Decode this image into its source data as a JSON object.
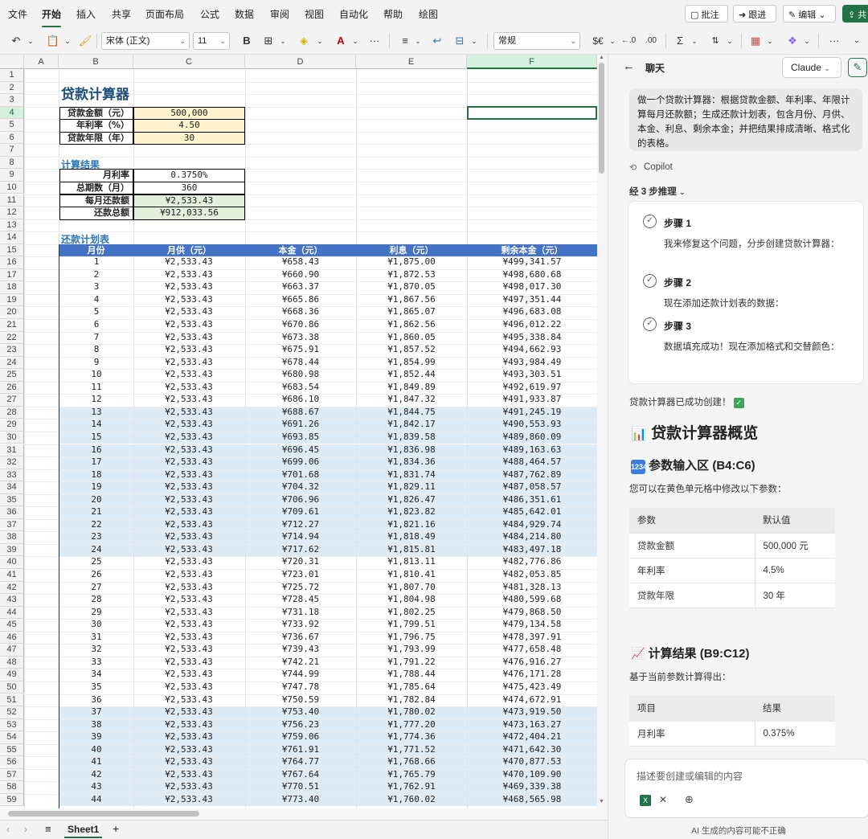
{
  "menu": {
    "items": [
      "文件",
      "开始",
      "插入",
      "共享",
      "页面布局",
      "公式",
      "数据",
      "审阅",
      "视图",
      "自动化",
      "帮助",
      "绘图"
    ],
    "active": "开始",
    "comment_label": "批注",
    "track_label": "跟进",
    "edit_label": "编辑",
    "share_label": "共"
  },
  "toolbar": {
    "font_name": "宋体 (正文)",
    "font_size": "11",
    "number_format": "常规",
    "bold": "B",
    "currency": "$€",
    "sigma": "Σ"
  },
  "columns": [
    "A",
    "B",
    "C",
    "D",
    "E",
    "F"
  ],
  "selected_column": "F",
  "selected_row": 4,
  "sheet": {
    "title": "贷款计算器",
    "inputs": [
      {
        "label": "贷款金额（元）",
        "value": "500,000"
      },
      {
        "label": "年利率（%）",
        "value": "4.50"
      },
      {
        "label": "贷款年限（年）",
        "value": "30"
      }
    ],
    "results_title": "计算结果",
    "results": [
      {
        "label": "月利率",
        "value": "0.3750%"
      },
      {
        "label": "总期数（月）",
        "value": "360"
      },
      {
        "label": "每月还款额",
        "value": "¥2,533.43"
      },
      {
        "label": "还款总额",
        "value": "¥912,033.56"
      }
    ],
    "schedule_title": "还款计划表",
    "headers": [
      "月份",
      "月供（元）",
      "本金（元）",
      "利息（元）",
      "剩余本金（元）"
    ],
    "rows": [
      [
        "1",
        "¥2,533.43",
        "¥658.43",
        "¥1,875.00",
        "¥499,341.57"
      ],
      [
        "2",
        "¥2,533.43",
        "¥660.90",
        "¥1,872.53",
        "¥498,680.68"
      ],
      [
        "3",
        "¥2,533.43",
        "¥663.37",
        "¥1,870.05",
        "¥498,017.30"
      ],
      [
        "4",
        "¥2,533.43",
        "¥665.86",
        "¥1,867.56",
        "¥497,351.44"
      ],
      [
        "5",
        "¥2,533.43",
        "¥668.36",
        "¥1,865.07",
        "¥496,683.08"
      ],
      [
        "6",
        "¥2,533.43",
        "¥670.86",
        "¥1,862.56",
        "¥496,012.22"
      ],
      [
        "7",
        "¥2,533.43",
        "¥673.38",
        "¥1,860.05",
        "¥495,338.84"
      ],
      [
        "8",
        "¥2,533.43",
        "¥675.91",
        "¥1,857.52",
        "¥494,662.93"
      ],
      [
        "9",
        "¥2,533.43",
        "¥678.44",
        "¥1,854.99",
        "¥493,984.49"
      ],
      [
        "10",
        "¥2,533.43",
        "¥680.98",
        "¥1,852.44",
        "¥493,303.51"
      ],
      [
        "11",
        "¥2,533.43",
        "¥683.54",
        "¥1,849.89",
        "¥492,619.97"
      ],
      [
        "12",
        "¥2,533.43",
        "¥686.10",
        "¥1,847.32",
        "¥491,933.87"
      ],
      [
        "13",
        "¥2,533.43",
        "¥688.67",
        "¥1,844.75",
        "¥491,245.19"
      ],
      [
        "14",
        "¥2,533.43",
        "¥691.26",
        "¥1,842.17",
        "¥490,553.93"
      ],
      [
        "15",
        "¥2,533.43",
        "¥693.85",
        "¥1,839.58",
        "¥489,860.09"
      ],
      [
        "16",
        "¥2,533.43",
        "¥696.45",
        "¥1,836.98",
        "¥489,163.63"
      ],
      [
        "17",
        "¥2,533.43",
        "¥699.06",
        "¥1,834.36",
        "¥488,464.57"
      ],
      [
        "18",
        "¥2,533.43",
        "¥701.68",
        "¥1,831.74",
        "¥487,762.89"
      ],
      [
        "19",
        "¥2,533.43",
        "¥704.32",
        "¥1,829.11",
        "¥487,058.57"
      ],
      [
        "20",
        "¥2,533.43",
        "¥706.96",
        "¥1,826.47",
        "¥486,351.61"
      ],
      [
        "21",
        "¥2,533.43",
        "¥709.61",
        "¥1,823.82",
        "¥485,642.01"
      ],
      [
        "22",
        "¥2,533.43",
        "¥712.27",
        "¥1,821.16",
        "¥484,929.74"
      ],
      [
        "23",
        "¥2,533.43",
        "¥714.94",
        "¥1,818.49",
        "¥484,214.80"
      ],
      [
        "24",
        "¥2,533.43",
        "¥717.62",
        "¥1,815.81",
        "¥483,497.18"
      ],
      [
        "25",
        "¥2,533.43",
        "¥720.31",
        "¥1,813.11",
        "¥482,776.86"
      ],
      [
        "26",
        "¥2,533.43",
        "¥723.01",
        "¥1,810.41",
        "¥482,053.85"
      ],
      [
        "27",
        "¥2,533.43",
        "¥725.72",
        "¥1,807.70",
        "¥481,328.13"
      ],
      [
        "28",
        "¥2,533.43",
        "¥728.45",
        "¥1,804.98",
        "¥480,599.68"
      ],
      [
        "29",
        "¥2,533.43",
        "¥731.18",
        "¥1,802.25",
        "¥479,868.50"
      ],
      [
        "30",
        "¥2,533.43",
        "¥733.92",
        "¥1,799.51",
        "¥479,134.58"
      ],
      [
        "31",
        "¥2,533.43",
        "¥736.67",
        "¥1,796.75",
        "¥478,397.91"
      ],
      [
        "32",
        "¥2,533.43",
        "¥739.43",
        "¥1,793.99",
        "¥477,658.48"
      ],
      [
        "33",
        "¥2,533.43",
        "¥742.21",
        "¥1,791.22",
        "¥476,916.27"
      ],
      [
        "34",
        "¥2,533.43",
        "¥744.99",
        "¥1,788.44",
        "¥476,171.28"
      ],
      [
        "35",
        "¥2,533.43",
        "¥747.78",
        "¥1,785.64",
        "¥475,423.49"
      ],
      [
        "36",
        "¥2,533.43",
        "¥750.59",
        "¥1,782.84",
        "¥474,672.91"
      ],
      [
        "37",
        "¥2,533.43",
        "¥753.40",
        "¥1,780.02",
        "¥473,919.50"
      ],
      [
        "38",
        "¥2,533.43",
        "¥756.23",
        "¥1,777.20",
        "¥473,163.27"
      ],
      [
        "39",
        "¥2,533.43",
        "¥759.06",
        "¥1,774.36",
        "¥472,404.21"
      ],
      [
        "40",
        "¥2,533.43",
        "¥761.91",
        "¥1,771.52",
        "¥471,642.30"
      ],
      [
        "41",
        "¥2,533.43",
        "¥764.77",
        "¥1,768.66",
        "¥470,877.53"
      ],
      [
        "42",
        "¥2,533.43",
        "¥767.64",
        "¥1,765.79",
        "¥470,109.90"
      ],
      [
        "43",
        "¥2,533.43",
        "¥770.51",
        "¥1,762.91",
        "¥469,339.38"
      ],
      [
        "44",
        "¥2,533.43",
        "¥773.40",
        "¥1,760.02",
        "¥468,565.98"
      ]
    ]
  },
  "tabs": {
    "sheet_name": "Sheet1",
    "add": "+"
  },
  "copilot": {
    "title": "聊天",
    "model": "Claude",
    "new_chat_icon": "compose-icon",
    "user_message": "做一个贷款计算器：根据贷款金额、年利率、年限计算每月还款额；生成还款计划表，包含月份、月供、本金、利息、剩余本金；并把结果排成清晰、格式化的表格。",
    "assistant_name": "Copilot",
    "reasoning_label": "经 3 步推理",
    "steps": [
      {
        "title": "步骤 1",
        "body": "我来修复这个问题，分步创建贷款计算器："
      },
      {
        "title": "步骤 2",
        "body": "现在添加还款计划表的数据："
      },
      {
        "title": "步骤 3",
        "body": "数据填充成功！现在添加格式和交替颜色："
      }
    ],
    "done_text": "贷款计算器已成功创建！",
    "overview_title": "贷款计算器概览",
    "input_section_title": "参数输入区 (B4:C6)",
    "input_section_text": "您可以在黄色单元格中修改以下参数：",
    "param_table": {
      "headers": [
        "参数",
        "默认值"
      ],
      "rows": [
        [
          "贷款金额",
          "500,000 元"
        ],
        [
          "年利率",
          "4.5%"
        ],
        [
          "贷款年限",
          "30 年"
        ]
      ]
    },
    "result_section_title": "计算结果 (B9:C12)",
    "result_section_text": "基于当前参数计算得出：",
    "result_table": {
      "headers": [
        "项目",
        "结果"
      ],
      "rows": [
        [
          "月利率",
          "0.375%"
        ]
      ]
    },
    "input_placeholder": "描述要创建或编辑的内容",
    "footnote": "AI 生成的内容可能不正确"
  }
}
